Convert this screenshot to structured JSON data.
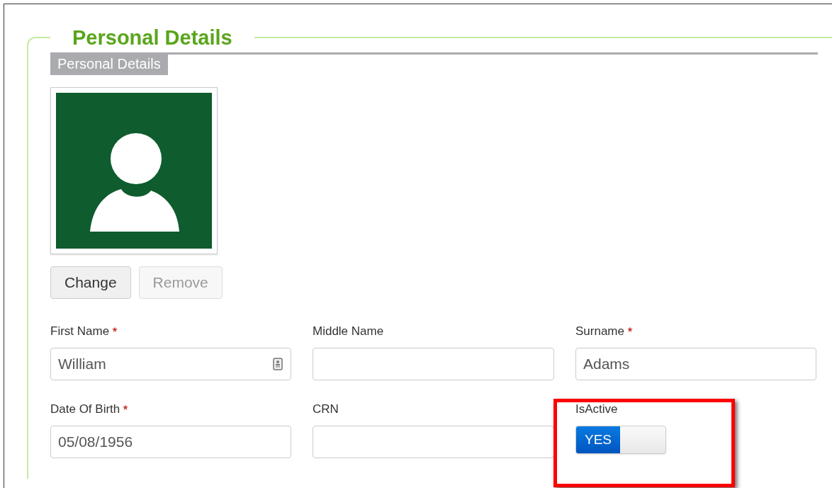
{
  "panel": {
    "legend": "Personal Details"
  },
  "section": {
    "title": "Personal Details"
  },
  "photo": {
    "kind": "avatar"
  },
  "photo_buttons": [
    {
      "label": "Change",
      "disabled": false
    },
    {
      "label": "Remove",
      "disabled": true
    }
  ],
  "fields": [
    {
      "kind": "text",
      "label": "First Name",
      "required": true,
      "value": "William",
      "card_icon": true
    },
    {
      "kind": "text",
      "label": "Middle Name",
      "required": false
    },
    {
      "kind": "text",
      "label": "Surname",
      "required": true,
      "value": "Adams"
    },
    {
      "kind": "text",
      "label": "Date Of Birth",
      "required": true,
      "value": "05/08/1956"
    },
    {
      "kind": "text",
      "label": "CRN",
      "required": false
    },
    {
      "kind": "toggle",
      "label": "IsActive",
      "required": false,
      "on": true,
      "on_text": "YES"
    }
  ]
}
